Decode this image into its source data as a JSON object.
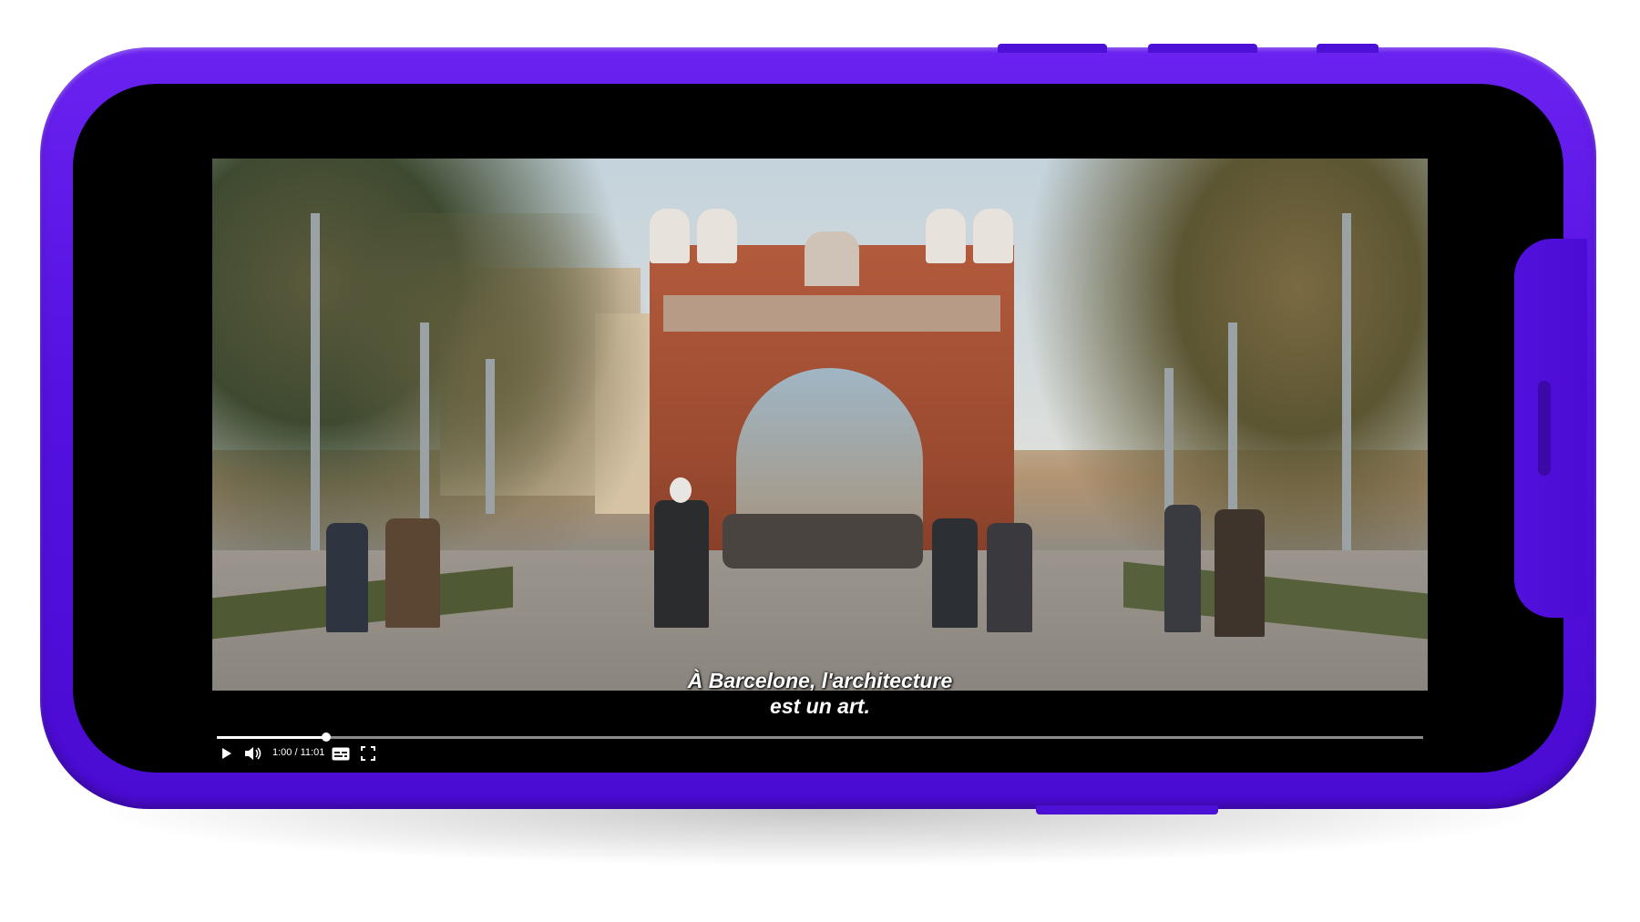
{
  "player": {
    "subtitle_line1": "À Barcelone, l'architecture",
    "subtitle_line2": "est un art.",
    "current_time": "1:00",
    "duration": "11:01",
    "progress": 0.0908
  },
  "controls": {
    "icons": [
      "play-icon",
      "volume-icon",
      "captions-icon",
      "fullscreen-icon"
    ]
  },
  "colors": {
    "phone_body": "#5411e0",
    "screen": "#000000",
    "progress_fill": "#ffffff",
    "progress_track": "#8a8a8a"
  }
}
